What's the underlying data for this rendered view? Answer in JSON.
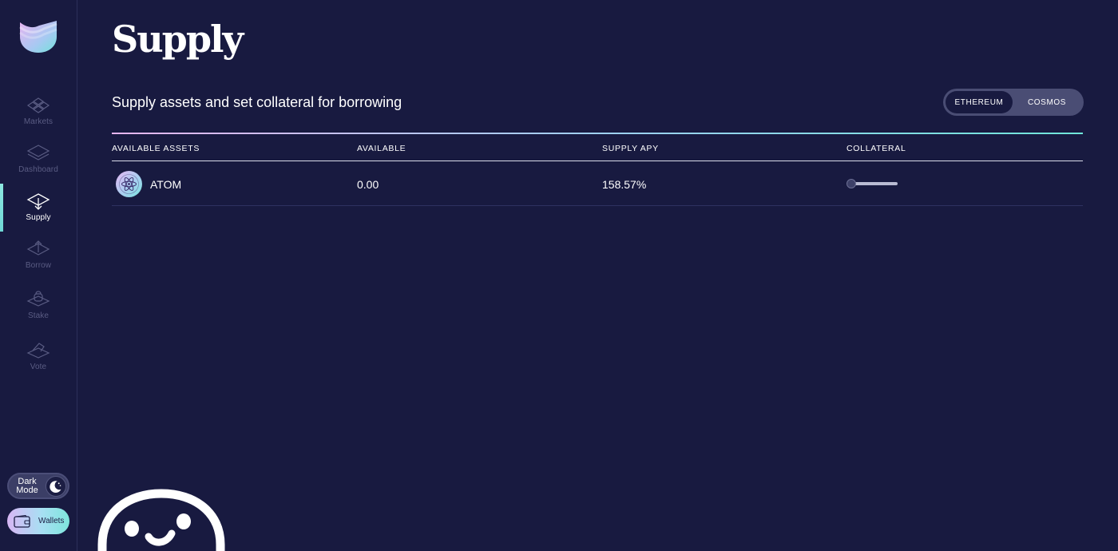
{
  "sidebar": {
    "items": [
      {
        "label": "Markets",
        "icon": "markets-icon"
      },
      {
        "label": "Dashboard",
        "icon": "dashboard-icon"
      },
      {
        "label": "Supply",
        "icon": "supply-icon",
        "active": true
      },
      {
        "label": "Borrow",
        "icon": "borrow-icon"
      },
      {
        "label": "Stake",
        "icon": "stake-icon"
      },
      {
        "label": "Vote",
        "icon": "vote-icon"
      }
    ],
    "dark_mode_label": "Dark Mode",
    "wallets_label": "Wallets"
  },
  "page": {
    "title": "Supply",
    "subtitle": "Supply assets and set collateral for borrowing"
  },
  "chain_toggle": {
    "options": [
      "ETHEREUM",
      "COSMOS"
    ],
    "selected": "ETHEREUM"
  },
  "table": {
    "headers": [
      "AVAILABLE ASSETS",
      "AVAILABLE",
      "SUPPLY APY",
      "COLLATERAL"
    ],
    "rows": [
      {
        "asset": "ATOM",
        "available": "0.00",
        "supply_apy": "158.57%",
        "collateral": false
      }
    ]
  },
  "colors": {
    "background": "#181a40",
    "accent_gradient_start": "#e6b6ef",
    "accent_gradient_end": "#6fe6da",
    "muted_text": "#5a5c83"
  }
}
